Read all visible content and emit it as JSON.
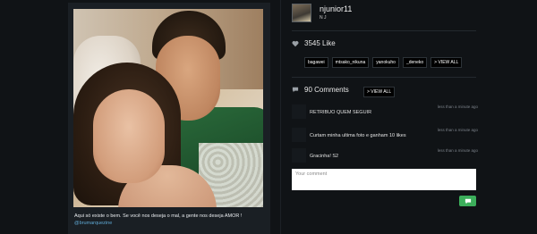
{
  "post": {
    "caption": "Aqui só existe o bem. Se você nos deseja o mal, a gente nos deseja AMOR !",
    "mention": "@brumarquezine"
  },
  "user": {
    "username": "njunior11",
    "display_name": "N J"
  },
  "likes": {
    "count_label": "3545 Like",
    "likers": [
      "bagawei",
      "mtsako_nikuna",
      "yanokuho",
      "_deneko"
    ],
    "view_all_label": "> VIEW ALL"
  },
  "comments": {
    "count_label": "90 Comments",
    "view_all_label": "> VIEW ALL",
    "items": [
      {
        "text": "RETRIBUO QUEM SEGUIR",
        "time": "less than a minute ago"
      },
      {
        "text": "Curtam minha ultima foto e ganham 10 likes",
        "time": "less than a minute ago"
      },
      {
        "text": "Gracinha! S2",
        "time": "less than a minute ago"
      }
    ],
    "input_placeholder": "Your comment"
  },
  "colors": {
    "background": "#101316",
    "panel": "#1a1f24",
    "send_button": "#3cae5b",
    "mention": "#5fa8d3"
  },
  "icons": {
    "like": "heart-icon",
    "comments": "speech-bubble-icon",
    "send": "chat-icon"
  }
}
